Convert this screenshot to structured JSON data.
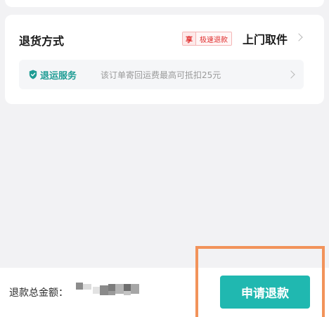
{
  "return_method": {
    "title": "退货方式",
    "badge_tag": "享",
    "badge_text": "极速退款",
    "method_value": "上门取件",
    "service": {
      "label": "退运服务",
      "description": "该订单寄回运费最高可抵扣25元"
    }
  },
  "footer": {
    "total_label": "退款总金额：",
    "apply_button_label": "申请退款"
  },
  "colors": {
    "accent": "#20b8b0",
    "service_text": "#1e9c94",
    "badge_red": "#e02e2e",
    "highlight": "#f2935a"
  }
}
